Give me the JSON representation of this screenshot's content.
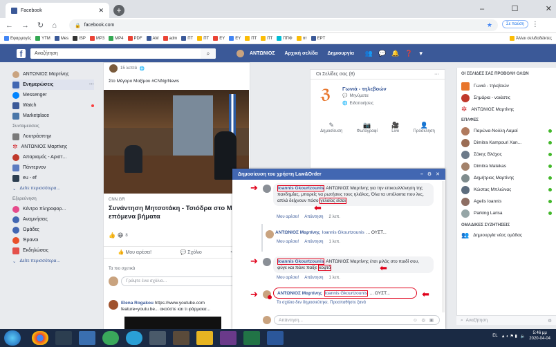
{
  "browser": {
    "tab_title": "Facebook",
    "address": "facebook.com",
    "profile_label": "Σε παύση",
    "bookmarks": [
      "Εφαρμογές",
      "YTM",
      "Mes",
      "ΙSP",
      "MP3",
      "MP4",
      "PDF",
      "AM",
      "adm",
      "ΠΤ",
      "ΠΤ",
      "EY",
      "EY",
      "ΠΤ",
      "ΠΤ",
      "ΠΠΦ",
      "rrr",
      "EPT"
    ],
    "other_bookmarks": "Άλλοι σελιδοδείκτες"
  },
  "fb": {
    "search_placeholder": "Αναζήτηση",
    "nav_user": "ΑΝΤΩΝΙΟΣ",
    "nav_home": "Αρχική σελίδα",
    "nav_create": "Δημιουργία"
  },
  "left": {
    "user": "ΑΝΤΩΝΙΟΣ Μαρτίνης",
    "main": [
      {
        "label": "Ενημερώσεις",
        "icon": "news-feed-icon",
        "color": "#4267b2"
      },
      {
        "label": "Messenger",
        "icon": "messenger-icon",
        "color": "#0084ff"
      },
      {
        "label": "Watch",
        "icon": "watch-icon",
        "color": "#3b5998"
      },
      {
        "label": "Marketplace",
        "icon": "marketplace-icon",
        "color": "#4a76a8"
      }
    ],
    "shortcuts_title": "Συντομεύσεις",
    "shortcuts": [
      {
        "label": "Λουτράσπηγι",
        "icon": "group-icon",
        "color": "#7a7a7a"
      },
      {
        "label": "ΑΝΤΩΝΙΟΣ Μαρτίνης",
        "icon": "star-icon",
        "color": "#d2262b"
      },
      {
        "label": "Απαριαμός - Αριστ...",
        "icon": "page-icon",
        "color": "#c0392b"
      },
      {
        "label": "Πάντερνον",
        "icon": "page-icon",
        "color": "#5b7bc0"
      },
      {
        "label": "eu - ef",
        "icon": "group-icon",
        "color": "#2c3e50"
      }
    ],
    "shortcuts_more": "Δείτε περισσότερα...",
    "explore_title": "Εξερεύνηση",
    "explore": [
      {
        "label": "Κέντρο πληροφορ...",
        "icon": "covid-info-icon",
        "color": "#e64a8b"
      },
      {
        "label": "Αναμνήσεις",
        "icon": "memories-icon",
        "color": "#4267b2"
      },
      {
        "label": "Ομάδες",
        "icon": "groups-icon",
        "color": "#4267b2"
      },
      {
        "label": "Έρανοι",
        "icon": "fundraiser-icon",
        "color": "#e9502a"
      },
      {
        "label": "Εκδηλώσεις",
        "icon": "events-icon",
        "color": "#e4504a"
      }
    ],
    "explore_more": "Δείτε περισσότερα..."
  },
  "post": {
    "time": "15 λεπτά",
    "text": "Στο Μέγαρο Μαξίμου #CNNgrNews",
    "source": "CNN.GR",
    "headline": "Συνάντηση Μητσοτάκη - Τσιόδρα στο Μ επόμενα βήματα",
    "reactions": "8",
    "like": "Μου αρέσει!",
    "comment": "Σχόλιο",
    "relevant": "Τα πιο σχετικά",
    "write_placeholder": "Γράψτε ένα σχόλιο...",
    "c_author": "Elena Rogakou",
    "c_text": "https://www.youtube.com feature=youtu.be... ακούστε και τι φάρμακα..."
  },
  "pages": {
    "title": "Οι Σελίδες σας (8)",
    "page_name": "Γωνιά - τηλεβοών",
    "messages": "Μηνύματα",
    "notifications": "Ειδοποιήσεις",
    "actions": [
      "Δημοσίευση",
      "Φωτογραφί",
      "Live",
      "Πρόσκληση"
    ]
  },
  "contacts": {
    "header": "ΟΙ ΣΕΛΙΔΕΣ ΣΑΣ  ΠΡΟΒΟΛΗ ΟΛΩΝ",
    "pages": [
      {
        "name": "Γωνιά - τηλεβοών",
        "color": "#e8762c"
      },
      {
        "name": "Σημάρια - νοιάστις",
        "color": "#c0392b"
      },
      {
        "name": "ΑΝΤΩΝΙΟΣ Μαρτίνης",
        "color": "#d2262b"
      }
    ],
    "contacts_title": "ΕΠΑΦΕΣ",
    "people": [
      {
        "name": "Παρώνα-Νούλη Λαμαί",
        "color": "#b07a5e"
      },
      {
        "name": "Dimitra Kampouri Xan...",
        "color": "#9b6d55"
      },
      {
        "name": "Σάκης Βλάχος",
        "color": "#6c7a89"
      },
      {
        "name": "Dimitra Matekas",
        "color": "#a3826b"
      },
      {
        "name": "Δημήτριος Μαρτίνης",
        "color": "#7f8c8d"
      },
      {
        "name": "Κώστας Μπλιώνας",
        "color": "#5d6d7e"
      },
      {
        "name": "Agelis Ioannis",
        "color": "#8d6e63"
      },
      {
        "name": "Parking Larisa",
        "color": "#95a5a6"
      }
    ],
    "groups_title": "ΟΜΑΔΙΚΕΣ ΣΥΖΗΤΗΣΕΙΣ",
    "new_group": "Δημιουργία νέας ομάδας",
    "search": "Αναζήτηση"
  },
  "chat": {
    "title": "Δημοσίευση του χρήστη Law&Order",
    "c1_name": "Ioannis Gkourtzounis",
    "c1_rest": "ΑΝΤΩΝΙΟΣ Μαρτίνης για την επικουλλύνηση της πανδημίας, μπορείς να ρωτήσεις τους ηλιόλος, Όλα τα υπόλοιπα που λες, απλά δείχνουν πόσο",
    "c1_boxed": "γελοίος είσαι",
    "c1_like": "Μου αρέσει!",
    "c1_reply": "Απάντηση",
    "c1_time": "2 λεπ.",
    "c2_name": "ΑΝΤΩΝΙΟΣ Μαρτίνης",
    "c2_tag": "Ioannis Gkourtzounis",
    "c2_rest": "... ΟΥΣΤ...",
    "c2_like": "Μου αρέσει!",
    "c2_reply": "Απάντηση",
    "c2_time": "1 λεπ.",
    "c3_name": "Ioannis Gkourtzounis",
    "c3_rest": "ΑΝΤΩΝΙΟΣ Μαρτίνης έτσι μιλάς στο παιδί σου, φύγε και πάνε παίξε",
    "c3_boxed": "κοφτό",
    "c3_like": "Μου αρέσει!",
    "c3_reply": "Απάντηση",
    "c3_time": "1 λεπ.",
    "c4_name": "ΑΝΤΩΝΙΟΣ Μαρτίνης",
    "c4_tag": "Ioannis Gkourtzounis",
    "c4_rest": "... ΟΥΣΤ...",
    "c4_meta": "Το σχόλιο δεν δημοσιεύτηκε. Προσπαθήστε ξανά",
    "write_placeholder": "Απάντηση...",
    "accent": "#e0001a"
  },
  "taskbar": {
    "lang": "EL",
    "time": "5:46 μμ",
    "date": "2020-04-04"
  }
}
